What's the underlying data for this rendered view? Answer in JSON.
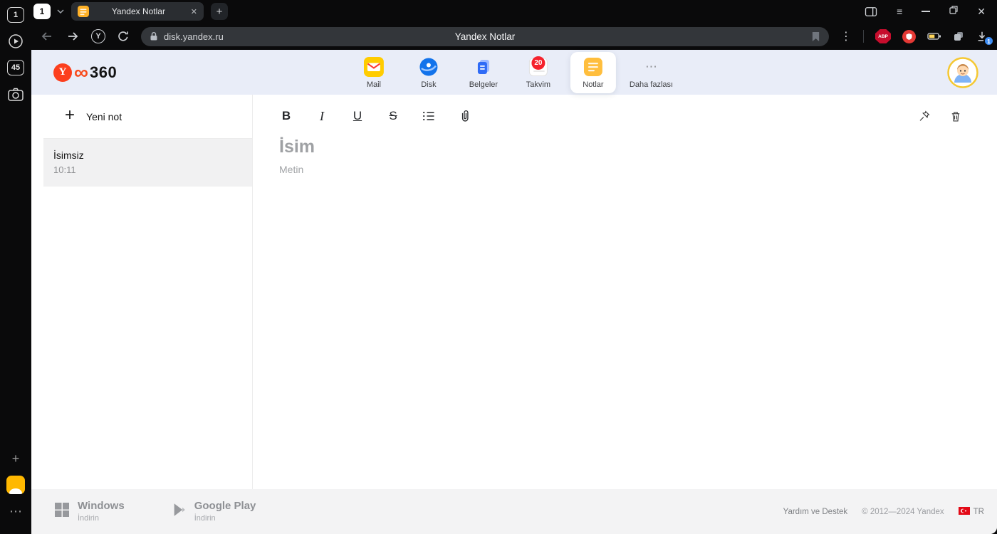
{
  "browser": {
    "sidebar": {
      "tab_count": "1",
      "counter_badge": "45"
    },
    "tabstrip": {
      "group_chip": "1",
      "tab_title": "Yandex Notlar"
    },
    "nav": {
      "url": "disk.yandex.ru",
      "page_title": "Yandex Notlar",
      "abp_label": "ABP",
      "download_badge": "1"
    }
  },
  "header": {
    "logo": {
      "y": "Y",
      "infinity": "∞",
      "suffix": "360"
    },
    "apps": [
      {
        "label": "Mail"
      },
      {
        "label": "Disk"
      },
      {
        "label": "Belgeler"
      },
      {
        "label": "Takvim",
        "badge": "20"
      },
      {
        "label": "Notlar"
      },
      {
        "label": "Daha fazlası"
      }
    ]
  },
  "notes": {
    "new_note_label": "Yeni not",
    "items": [
      {
        "title": "İsimsiz",
        "time": "10:11"
      }
    ],
    "toolbar": {
      "bold": "B",
      "italic": "I",
      "underline": "U",
      "strikethrough": "S"
    },
    "editor": {
      "title_placeholder": "İsim",
      "body_placeholder": "Metin"
    }
  },
  "footer": {
    "windows": {
      "title": "Windows",
      "subtitle": "İndirin"
    },
    "google_play": {
      "title": "Google Play",
      "subtitle": "İndirin"
    },
    "help": "Yardım ve Destek",
    "copyright": "© 2012—2024 Yandex",
    "language": "TR"
  },
  "icons": {
    "plus": "+",
    "ellipsis": "⋯",
    "kebab": "⋮",
    "hamburger": "≡",
    "close": "✕"
  },
  "colors": {
    "chrome_bg": "#0a0a0b",
    "header_bg": "#e9edf8",
    "accent_red": "#fc3f1d",
    "mail_yellow": "#ffcc00",
    "disk_blue": "#1273eb",
    "docs_blue": "#2f6bf6",
    "notes_yellow": "#ffbe3d",
    "badge_red": "#f5222d",
    "download_badge_blue": "#3d8df5"
  }
}
